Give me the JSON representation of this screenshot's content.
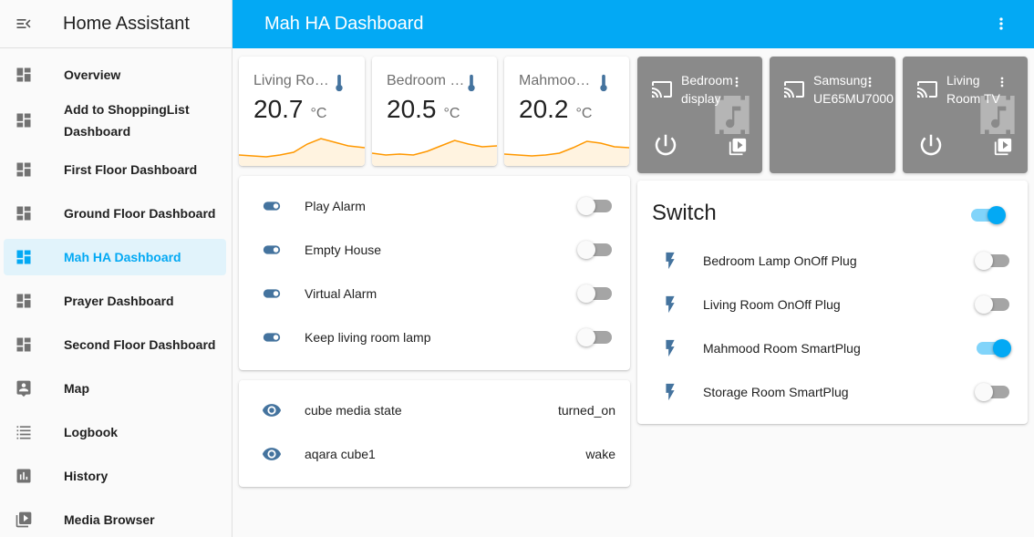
{
  "sidebar": {
    "title": "Home Assistant",
    "items": [
      {
        "label": "Overview",
        "icon": "dashboard-icon"
      },
      {
        "label": "Add to ShoppingList Dashboard",
        "icon": "dashboard-icon"
      },
      {
        "label": "First Floor Dashboard",
        "icon": "dashboard-icon"
      },
      {
        "label": "Ground Floor Dashboard",
        "icon": "dashboard-icon"
      },
      {
        "label": "Mah HA Dashboard",
        "icon": "dashboard-icon",
        "active": true
      },
      {
        "label": "Prayer Dashboard",
        "icon": "dashboard-icon"
      },
      {
        "label": "Second Floor Dashboard",
        "icon": "dashboard-icon"
      },
      {
        "label": "Map",
        "icon": "map-icon"
      },
      {
        "label": "Logbook",
        "icon": "logbook-icon"
      },
      {
        "label": "History",
        "icon": "history-icon"
      },
      {
        "label": "Media Browser",
        "icon": "media-browser-icon"
      }
    ]
  },
  "header": {
    "title": "Mah HA Dashboard"
  },
  "sensors": [
    {
      "name": "Living Ro…",
      "value": "20.7",
      "unit": "°C"
    },
    {
      "name": "Bedroom …",
      "value": "20.5",
      "unit": "°C"
    },
    {
      "name": "Mahmoo…",
      "value": "20.2",
      "unit": "°C"
    }
  ],
  "media_players": [
    {
      "name": "Bedroom display",
      "has_controls": true
    },
    {
      "name": "Samsung UE65MU7000",
      "has_controls": false
    },
    {
      "name": "Living Room TV",
      "has_controls": true
    }
  ],
  "automations": [
    {
      "label": "Play Alarm",
      "on": false
    },
    {
      "label": "Empty House",
      "on": false
    },
    {
      "label": "Virtual Alarm",
      "on": false
    },
    {
      "label": "Keep living room lamp",
      "on": false
    }
  ],
  "states": [
    {
      "label": "cube media state",
      "value": "turned_on"
    },
    {
      "label": "aqara cube1",
      "value": "wake"
    }
  ],
  "switch_card": {
    "title": "Switch",
    "master_on": true,
    "items": [
      {
        "label": "Bedroom Lamp OnOff Plug",
        "on": false
      },
      {
        "label": "Living Room OnOff Plug",
        "on": false
      },
      {
        "label": "Mahmood Room SmartPlug",
        "on": true
      },
      {
        "label": "Storage Room SmartPlug",
        "on": false
      }
    ]
  },
  "colors": {
    "primary": "#03a9f4",
    "icon_blue": "#44739e",
    "sparkline": "#ff9800",
    "media_bg": "#8a8a8a"
  }
}
